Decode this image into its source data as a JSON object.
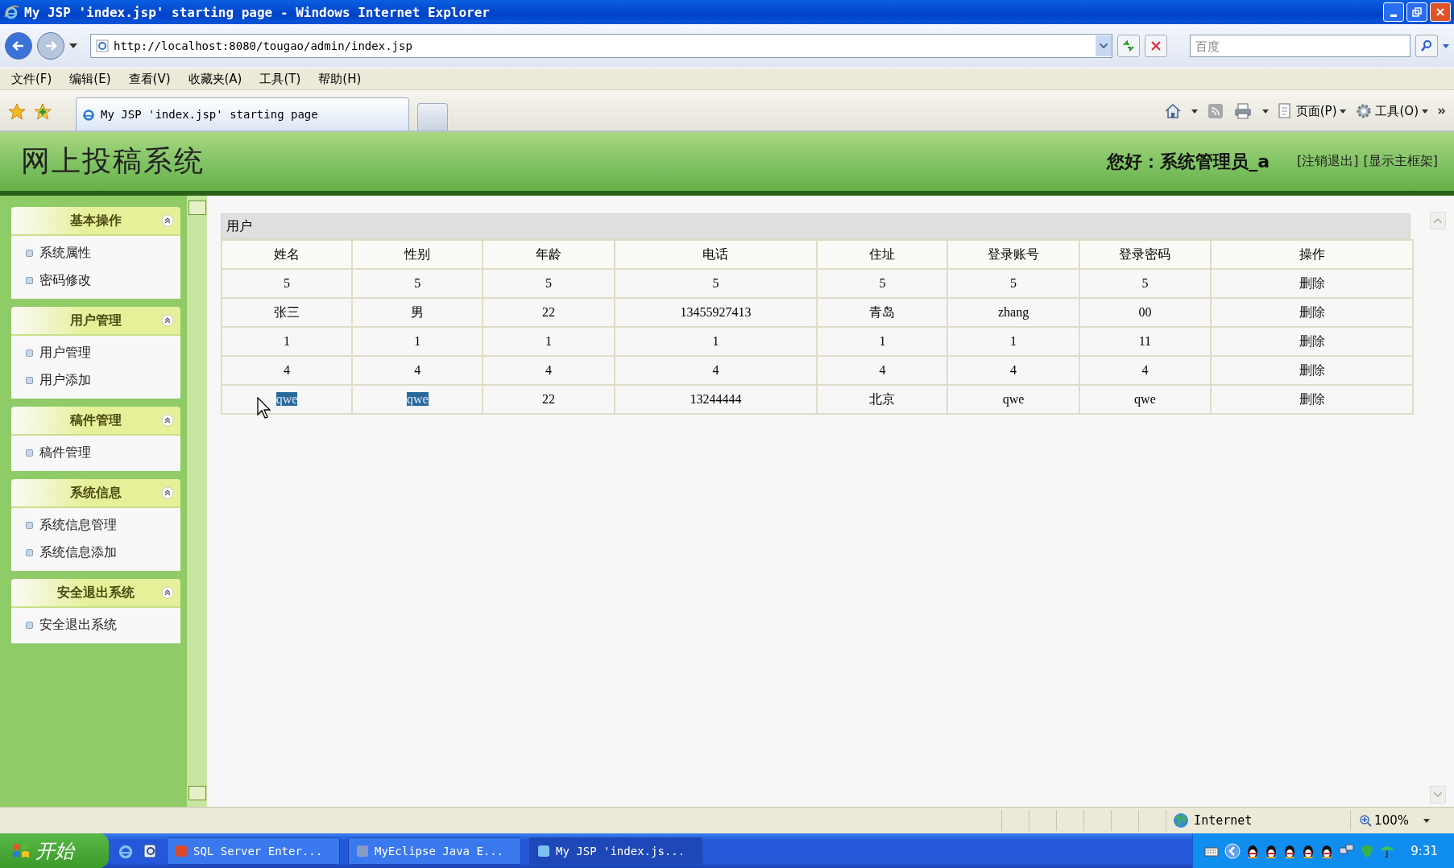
{
  "window": {
    "title": "My JSP 'index.jsp' starting page - Windows Internet Explorer"
  },
  "address_bar": {
    "url": "http://localhost:8080/tougao/admin/index.jsp"
  },
  "search": {
    "placeholder": "百度"
  },
  "menu_bar": [
    "文件(F)",
    "编辑(E)",
    "查看(V)",
    "收藏夹(A)",
    "工具(T)",
    "帮助(H)"
  ],
  "tabs": [
    {
      "label": "My JSP 'index.jsp' starting page",
      "selected": true
    }
  ],
  "command_bar": [
    "页面(P)",
    "工具(O)"
  ],
  "page": {
    "site_title": "网上投稿系统",
    "greeting": "您好：系统管理员_a",
    "links": [
      "[注销退出]",
      "[显示主框架]"
    ]
  },
  "sidebar": {
    "sections": [
      {
        "title": "基本操作",
        "expanded": true,
        "items": [
          "系统属性",
          "密码修改"
        ]
      },
      {
        "title": "用户管理",
        "expanded": true,
        "items": [
          "用户管理",
          "用户添加"
        ]
      },
      {
        "title": "稿件管理",
        "expanded": true,
        "items": [
          "稿件管理"
        ]
      },
      {
        "title": "系统信息",
        "expanded": true,
        "items": [
          "系统信息管理",
          "系统信息添加"
        ]
      },
      {
        "title": "安全退出系统",
        "expanded": true,
        "items": [
          "安全退出系统"
        ]
      }
    ]
  },
  "table": {
    "caption": "用户",
    "columns": [
      "姓名",
      "性别",
      "年龄",
      "电话",
      "住址",
      "登录账号",
      "登录密码",
      "操作"
    ],
    "rows": [
      {
        "cells": [
          {
            "text": "5",
            "highlighted": false
          },
          {
            "text": "5",
            "highlighted": false
          },
          {
            "text": "5",
            "highlighted": false
          },
          {
            "text": "5",
            "highlighted": false
          },
          {
            "text": "5",
            "highlighted": false
          },
          {
            "text": "5",
            "highlighted": false
          },
          {
            "text": "5",
            "highlighted": false
          }
        ],
        "action": "删除"
      },
      {
        "cells": [
          {
            "text": "张三",
            "highlighted": false
          },
          {
            "text": "男",
            "highlighted": false
          },
          {
            "text": "22",
            "highlighted": false
          },
          {
            "text": "13455927413",
            "highlighted": false
          },
          {
            "text": "青岛",
            "highlighted": false
          },
          {
            "text": "zhang",
            "highlighted": false
          },
          {
            "text": "00",
            "highlighted": false
          }
        ],
        "action": "删除"
      },
      {
        "cells": [
          {
            "text": "1",
            "highlighted": false
          },
          {
            "text": "1",
            "highlighted": false
          },
          {
            "text": "1",
            "highlighted": false
          },
          {
            "text": "1",
            "highlighted": false
          },
          {
            "text": "1",
            "highlighted": false
          },
          {
            "text": "1",
            "highlighted": false
          },
          {
            "text": "11",
            "highlighted": false
          }
        ],
        "action": "删除"
      },
      {
        "cells": [
          {
            "text": "4",
            "highlighted": false
          },
          {
            "text": "4",
            "highlighted": false
          },
          {
            "text": "4",
            "highlighted": false
          },
          {
            "text": "4",
            "highlighted": false
          },
          {
            "text": "4",
            "highlighted": false
          },
          {
            "text": "4",
            "highlighted": false
          },
          {
            "text": "4",
            "highlighted": false
          }
        ],
        "action": "删除"
      },
      {
        "cells": [
          {
            "text": "qwe",
            "highlighted": true
          },
          {
            "text": "qwe",
            "highlighted": true
          },
          {
            "text": "22",
            "highlighted": false
          },
          {
            "text": "13244444",
            "highlighted": false
          },
          {
            "text": "北京",
            "highlighted": false
          },
          {
            "text": "qwe",
            "highlighted": false
          },
          {
            "text": "qwe",
            "highlighted": false
          }
        ],
        "action": "删除"
      }
    ]
  },
  "status_bar": {
    "zone": "Internet",
    "zoom": "100%"
  },
  "taskbar": {
    "start": "开始",
    "tasks": [
      {
        "label": "SQL Server Enter...",
        "selected": false
      },
      {
        "label": "MyEclipse Java E...",
        "selected": false
      },
      {
        "label": "My JSP 'index.js...",
        "selected": true
      }
    ],
    "clock": "9:31"
  }
}
